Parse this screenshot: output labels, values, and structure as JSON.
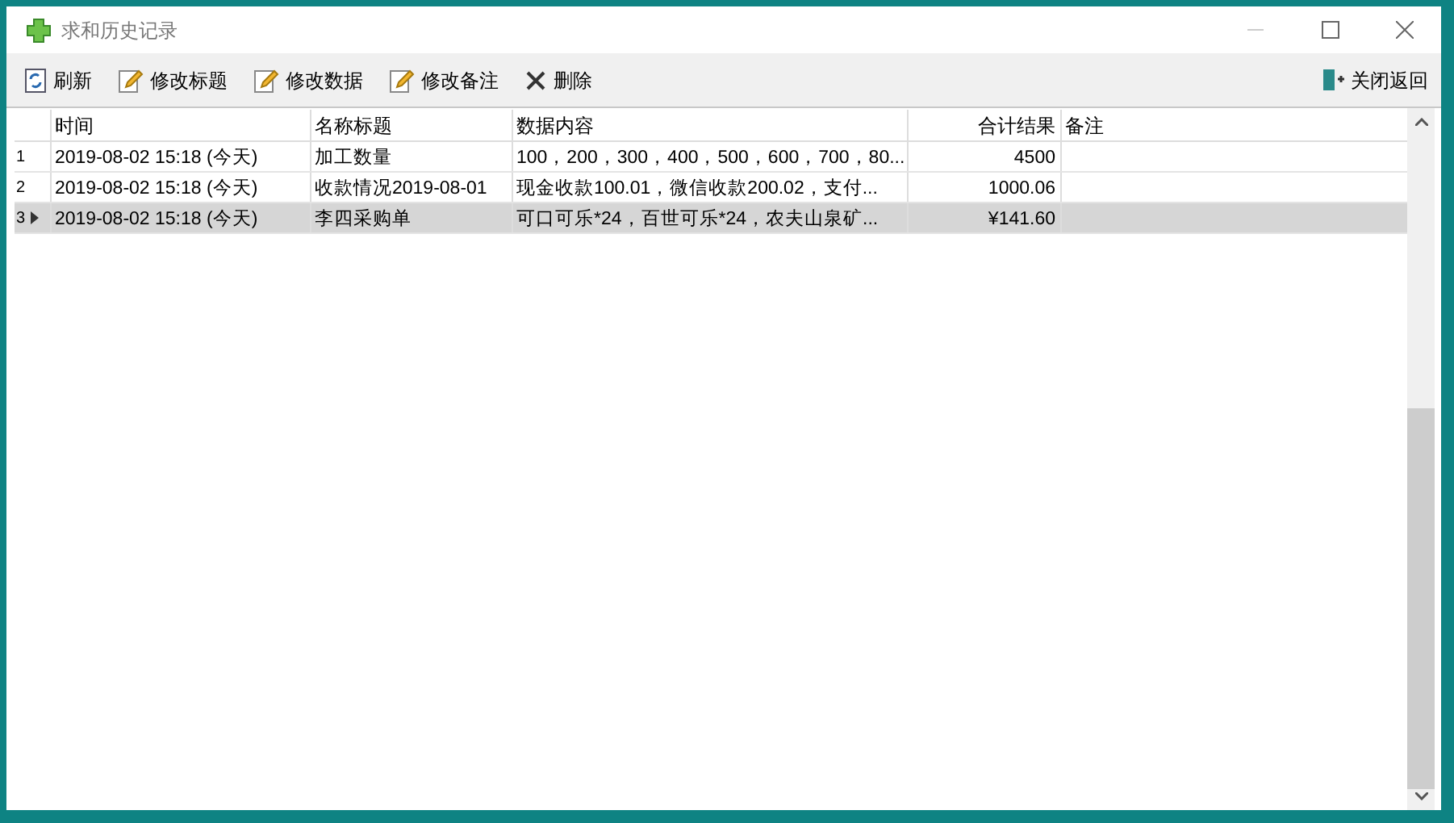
{
  "window": {
    "title": "求和历史记录"
  },
  "toolbar": [
    {
      "label": "刷新",
      "kind": "refresh"
    },
    {
      "label": "修改标题",
      "kind": "edit"
    },
    {
      "label": "修改数据",
      "kind": "edit"
    },
    {
      "label": "修改备注",
      "kind": "edit"
    },
    {
      "label": "删除",
      "kind": "delete"
    }
  ],
  "close_return": {
    "label": "关闭返回"
  },
  "table": {
    "columns": [
      "时间",
      "名称标题",
      "数据内容",
      "合计结果",
      "备注"
    ],
    "rows": [
      {
        "index": "1",
        "selected": false,
        "cells": [
          "2019-08-02 15:18 (今天)",
          "加工数量",
          "100，200，300，400，500，600，700，80...",
          "4500",
          ""
        ]
      },
      {
        "index": "2",
        "selected": false,
        "cells": [
          "2019-08-02 15:18 (今天)",
          "收款情况2019-08-01",
          "现金收款100.01，微信收款200.02，支付...",
          "1000.06",
          ""
        ]
      },
      {
        "index": "3",
        "selected": true,
        "cells": [
          "2019-08-02 15:18 (今天)",
          "李四采购单",
          "可口可乐*24，百世可乐*24，农夫山泉矿...",
          "¥141.60",
          ""
        ]
      }
    ]
  }
}
